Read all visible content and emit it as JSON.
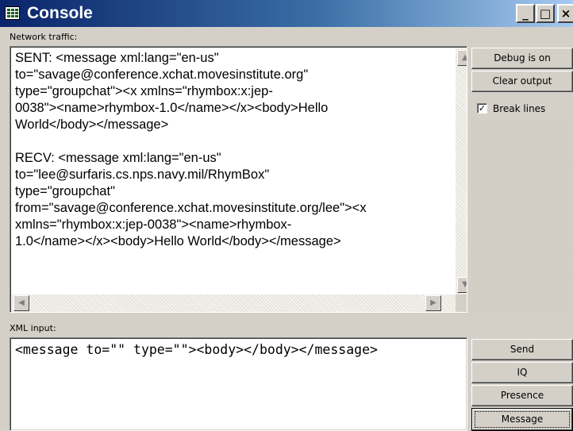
{
  "window": {
    "title": "Console",
    "app_icon": "console-grid-icon",
    "controls": [
      {
        "name": "minimize",
        "glyph": "_"
      },
      {
        "name": "maximize",
        "glyph": "□"
      },
      {
        "name": "close",
        "glyph": "×"
      }
    ],
    "colors": {
      "titlebar_start": "#0a246a",
      "titlebar_end": "#a6caf0",
      "face": "#d4d0c8"
    }
  },
  "network": {
    "label": "Network traffic:",
    "text": "SENT: <message xml:lang=\"en-us\"\nto=\"savage@conference.xchat.movesinstitute.org\"\ntype=\"groupchat\"><x xmlns=\"rhymbox:x:jep-\n0038\"><name>rhymbox-1.0</name></x><body>Hello\nWorld</body></message>\n\nRECV: <message xml:lang=\"en-us\"\nto=\"lee@surfaris.cs.nps.navy.mil/RhymBox\"\ntype=\"groupchat\"\nfrom=\"savage@conference.xchat.movesinstitute.org/lee\"><x\nxmlns=\"rhymbox:x:jep-0038\"><name>rhymbox-\n1.0</name></x><body>Hello World</body></message>",
    "scroll_up": "▲",
    "scroll_down": "▼",
    "scroll_left": "◀",
    "scroll_right": "▶"
  },
  "side_buttons": {
    "debug": "Debug is on",
    "clear": "Clear output",
    "break_lines": {
      "label": "Break lines",
      "checked": true,
      "mark": "✓"
    }
  },
  "xml_input": {
    "label": "XML input:",
    "value": "<message to=\"\" type=\"\"><body></body></message>"
  },
  "send_buttons": {
    "send": "Send",
    "iq": "IQ",
    "presence": "Presence",
    "message": "Message"
  }
}
